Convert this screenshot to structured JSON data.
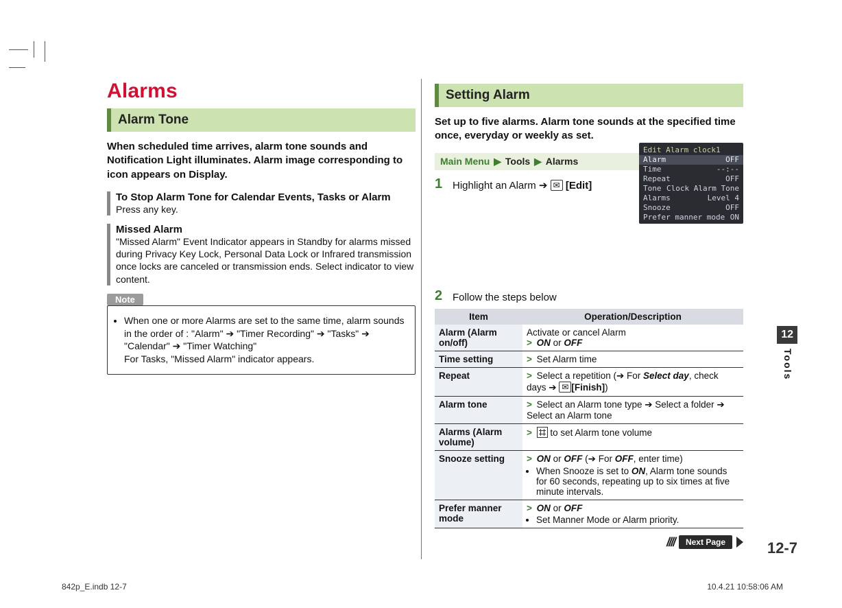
{
  "page": {
    "main_title": "Alarms",
    "chapter_tab": "12",
    "chapter_label": "Tools",
    "page_number": "12-7",
    "next_page_label": "Next Page",
    "footer_left": "842p_E.indb   12-7",
    "footer_right": "10.4.21   10:58:06 AM"
  },
  "left_col": {
    "section_title": "Alarm Tone",
    "intro": "When scheduled time arrives, alarm tone sounds and Notification Light illuminates. Alarm image corresponding to icon appears on Display.",
    "stop_title": "To Stop Alarm Tone for Calendar Events, Tasks or Alarm",
    "stop_body": "Press any key.",
    "missed_title": "Missed Alarm",
    "missed_body": "\"Missed Alarm\" Event Indicator appears in Standby for alarms missed during Privacy Key Lock, Personal Data Lock or Infrared transmission once locks are canceled or transmission ends. Select indicator to view content.",
    "note_label": "Note",
    "note_item1a": "When one or more Alarms are set to the same time, alarm sounds in the order of : \"Alarm\" ➔ \"Timer Recording\" ➔ \"Tasks\" ➔ \"Calendar\" ➔ \"Timer Watching\"",
    "note_item1b": "For Tasks, \"Missed Alarm\" indicator appears."
  },
  "right_col": {
    "section_title": "Setting Alarm",
    "intro": "Set up to five alarms. Alarm tone sounds at the specified time once, everyday or weekly as set.",
    "breadcrumb": {
      "main_menu": "Main Menu",
      "tools": "Tools",
      "alarms": "Alarms"
    },
    "step1": {
      "num": "1",
      "text_a": "Highlight an Alarm ➔ ",
      "edit_label": "[Edit]"
    },
    "step2": {
      "num": "2",
      "text": "Follow the steps below"
    },
    "screenshot": {
      "title": "Edit Alarm clock1",
      "rows": [
        {
          "l": "Alarm",
          "r": "OFF"
        },
        {
          "l": "Time",
          "r": "--:--"
        },
        {
          "l": "Repeat",
          "r": "OFF"
        },
        {
          "l": "Tone",
          "r": "Clock Alarm Tone"
        },
        {
          "l": "Alarms",
          "r": "Level 4"
        },
        {
          "l": "Snooze",
          "r": "OFF"
        },
        {
          "l": "Prefer manner mode",
          "r": "ON"
        }
      ]
    },
    "table": {
      "head_item": "Item",
      "head_op": "Operation/Description",
      "rows": [
        {
          "item": "Alarm (Alarm on/off)",
          "lines": [
            {
              "plain": "Activate or cancel Alarm"
            },
            {
              "gt": true,
              "html": "<b><i>ON</i></b> or <b><i>OFF</i></b>"
            }
          ]
        },
        {
          "item": "Time setting",
          "lines": [
            {
              "gt": true,
              "html": "Set Alarm time"
            }
          ]
        },
        {
          "item": "Repeat",
          "lines": [
            {
              "gt": true,
              "html": "Select a repetition (➔ For <b><i>Select day</i></b>, check days ➔ <span class='keybox'>✉</span><b>[Finish]</b>)"
            }
          ]
        },
        {
          "item": "Alarm tone",
          "lines": [
            {
              "gt": true,
              "html": "Select an Alarm tone type ➔ Select a folder ➔ Select an Alarm tone"
            }
          ]
        },
        {
          "item": "Alarms (Alarm volume)",
          "lines": [
            {
              "gt": true,
              "html": "<span class='dpad'></span> to set Alarm tone volume"
            }
          ]
        },
        {
          "item": "Snooze setting",
          "lines": [
            {
              "gt": true,
              "html": "<b><i>ON</i></b> or <b><i>OFF</i></b> (➔ For <b><i>OFF</i></b>, enter time)"
            },
            {
              "bullet": true,
              "html": "When Snooze is set to <b><i>ON</i></b>, Alarm tone sounds for 60 seconds, repeating up to six times at five minute intervals."
            }
          ]
        },
        {
          "item": "Prefer manner mode",
          "lines": [
            {
              "gt": true,
              "html": "<b><i>ON</i></b> or <b><i>OFF</i></b>"
            },
            {
              "bullet": true,
              "html": "Set Manner Mode or Alarm priority."
            }
          ]
        }
      ]
    }
  }
}
